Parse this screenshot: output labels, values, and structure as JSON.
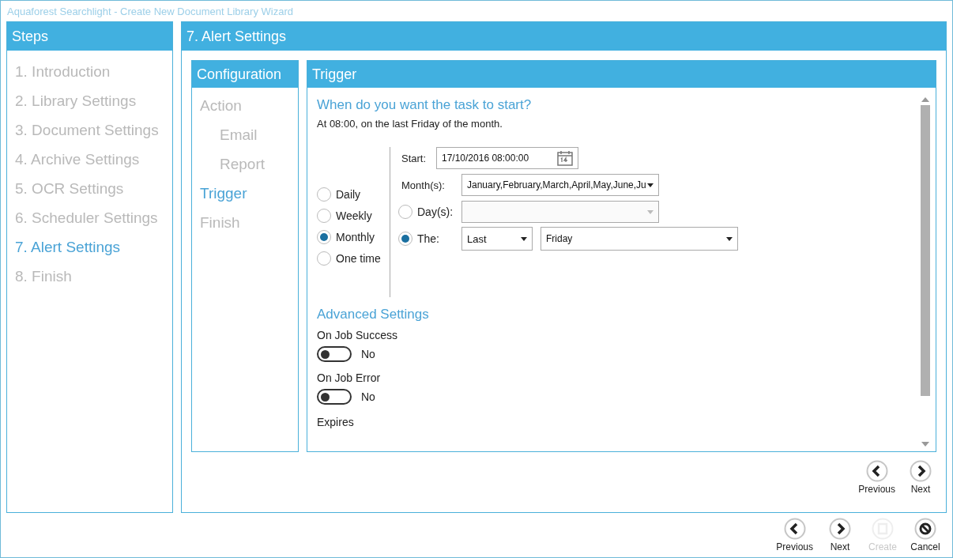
{
  "window": {
    "title": "Aquaforest Searchlight - Create New Document Library Wizard"
  },
  "steps": {
    "title": "Steps",
    "items": [
      {
        "label": "1. Introduction",
        "selected": false
      },
      {
        "label": "2. Library Settings",
        "selected": false
      },
      {
        "label": "3. Document Settings",
        "selected": false
      },
      {
        "label": "4. Archive Settings",
        "selected": false
      },
      {
        "label": "5. OCR Settings",
        "selected": false
      },
      {
        "label": "6. Scheduler Settings",
        "selected": false
      },
      {
        "label": "7. Alert Settings",
        "selected": true
      },
      {
        "label": "8. Finish",
        "selected": false
      }
    ]
  },
  "page": {
    "title": "7. Alert Settings"
  },
  "configuration": {
    "title": "Configuration",
    "items": [
      {
        "label": "Action",
        "selected": false,
        "children": [
          {
            "label": "Email",
            "selected": false
          },
          {
            "label": "Report",
            "selected": false
          }
        ]
      },
      {
        "label": "Trigger",
        "selected": true
      },
      {
        "label": "Finish",
        "selected": false
      }
    ]
  },
  "trigger": {
    "title": "Trigger",
    "heading": "When do you want the task to start?",
    "summary": "At 08:00, on the last Friday of the month.",
    "frequencies": [
      {
        "label": "Daily",
        "selected": false
      },
      {
        "label": "Weekly",
        "selected": false
      },
      {
        "label": "Monthly",
        "selected": true
      },
      {
        "label": "One time",
        "selected": false
      }
    ],
    "start": {
      "label": "Start:",
      "value": "17/10/2016 08:00:00"
    },
    "months": {
      "label": "Month(s):",
      "value": "January,February,March,April,May,June,Ju"
    },
    "days": {
      "label": "Day(s):",
      "selected": false,
      "disabled": true
    },
    "the": {
      "label": "The:",
      "selected": true,
      "ordinal": "Last",
      "weekday": "Friday"
    },
    "advanced": {
      "title": "Advanced Settings",
      "toggles": [
        {
          "label": "On Job Success",
          "on": false,
          "state": "No"
        },
        {
          "label": "On Job Error",
          "on": false,
          "state": "No"
        }
      ],
      "expires": "Expires"
    }
  },
  "inner_nav": [
    {
      "kind": "previous",
      "label": "Previous",
      "disabled": false
    },
    {
      "kind": "next",
      "label": "Next",
      "disabled": false
    }
  ],
  "footer": [
    {
      "kind": "previous",
      "label": "Previous",
      "disabled": false
    },
    {
      "kind": "next",
      "label": "Next",
      "disabled": false
    },
    {
      "kind": "create",
      "label": "Create",
      "disabled": true
    },
    {
      "kind": "cancel",
      "label": "Cancel",
      "disabled": false
    }
  ]
}
